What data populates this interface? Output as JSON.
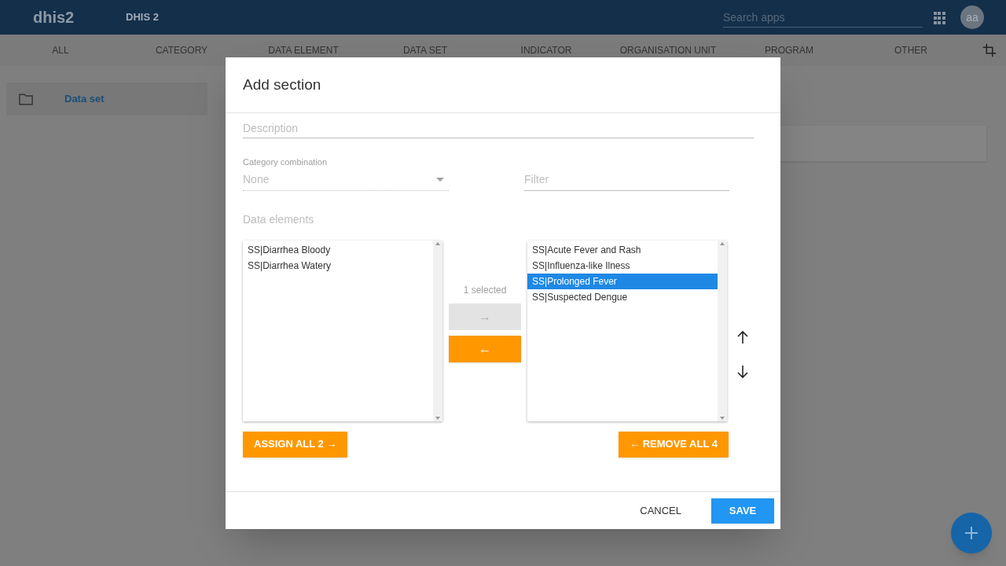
{
  "header": {
    "logo": "dhis2",
    "app_title": "DHIS 2",
    "search": {
      "placeholder": "Search apps"
    },
    "avatar": "aa"
  },
  "tabs": [
    "ALL",
    "CATEGORY",
    "DATA ELEMENT",
    "DATA SET",
    "INDICATOR",
    "ORGANISATION UNIT",
    "PROGRAM",
    "OTHER"
  ],
  "sidebar": {
    "items": [
      {
        "label": "Data set"
      }
    ]
  },
  "dialog": {
    "title": "Add section",
    "description": {
      "placeholder": "Description"
    },
    "category_combination": {
      "label": "Category combination",
      "value": "None"
    },
    "filter": {
      "placeholder": "Filter"
    },
    "data_elements_label": "Data elements",
    "available": [
      {
        "label": "SS|Diarrhea Bloody",
        "selected": false
      },
      {
        "label": "SS|Diarrhea Watery",
        "selected": false
      }
    ],
    "assigned": [
      {
        "label": "SS|Acute Fever and Rash",
        "selected": false
      },
      {
        "label": "SS|Influenza-like Ilness",
        "selected": false
      },
      {
        "label": "SS|Prolonged Fever",
        "selected": true
      },
      {
        "label": "SS|Suspected Dengue",
        "selected": false
      }
    ],
    "selection_count": "1 selected",
    "assign_button": {
      "label": "→",
      "disabled": true
    },
    "remove_button": {
      "label": "←",
      "disabled": false
    },
    "assign_all": "ASSIGN ALL 2 →",
    "remove_all": "← REMOVE ALL 4",
    "cancel": "CANCEL",
    "save": "SAVE"
  }
}
